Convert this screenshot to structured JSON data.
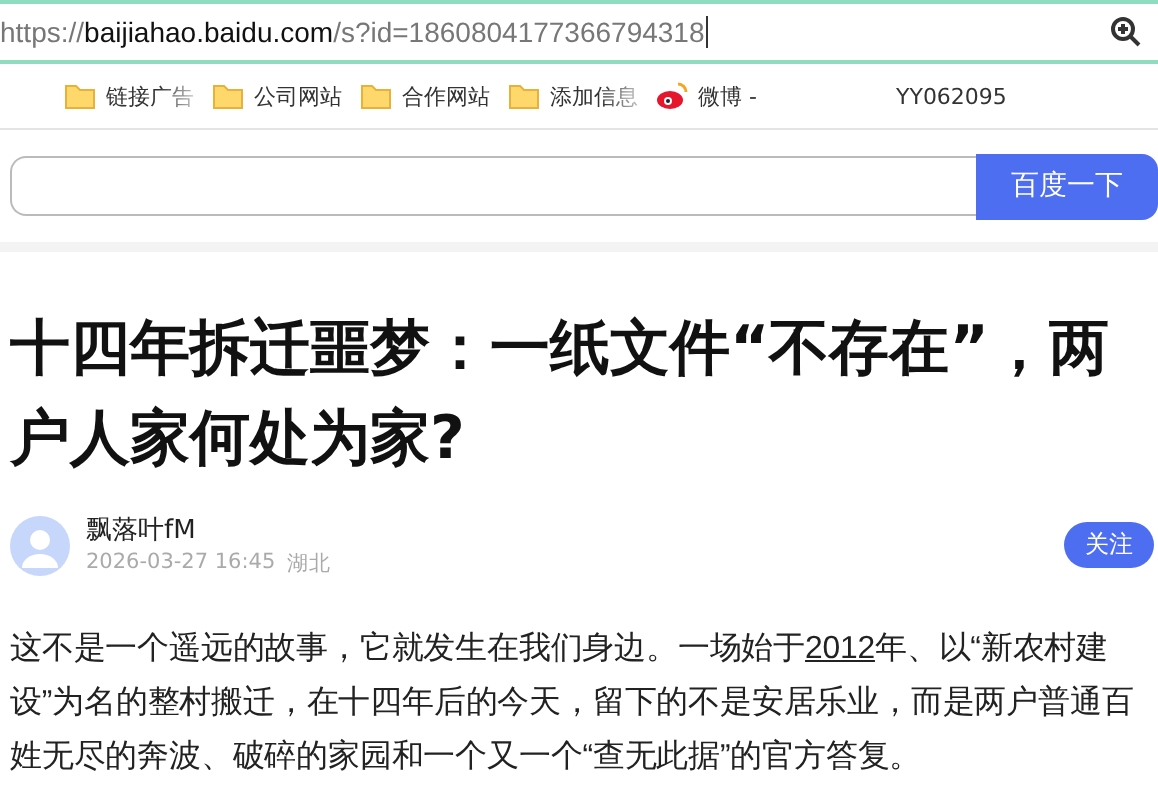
{
  "address_bar": {
    "url_prefix": "https://",
    "url_host": "baijiahao.baidu.com",
    "url_path": "/s?id=1860804177366794318"
  },
  "bookmarks": [
    {
      "label": "链接广告",
      "kind": "folder"
    },
    {
      "label": "公司网站",
      "kind": "folder"
    },
    {
      "label": "合作网站",
      "kind": "folder"
    },
    {
      "label": "添加信息",
      "kind": "folder"
    },
    {
      "label": "微博 -",
      "kind": "weibo"
    },
    {
      "label": "YY062095",
      "kind": "plain"
    }
  ],
  "search": {
    "button": "百度一下"
  },
  "article": {
    "title": "十四年拆迁噩梦：一纸文件“不存在”，两户人家何处为家?",
    "author": "飘落叶fM",
    "date": "2026-03-27 16:45",
    "location": "湖北",
    "follow": "关注",
    "paragraph_before": "这不是一个遥远的故事，它就发生在我们身边。一场始于",
    "paragraph_link": "2012",
    "paragraph_after": "年、以“新农村建设”为名的整村搬迁，在十四年后的今天，留下的不是安居乐业，而是两户普通百姓无尽的奔波、破碎的家园和一个又一个“查无此据”的官方答复。"
  }
}
